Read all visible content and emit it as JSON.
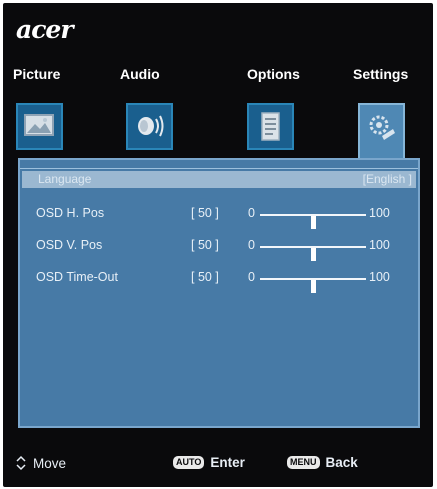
{
  "brand": {
    "logo_text": "acer"
  },
  "tabs": [
    {
      "label": "Picture",
      "icon": "picture-icon"
    },
    {
      "label": "Audio",
      "icon": "audio-icon"
    },
    {
      "label": "Options",
      "icon": "options-icon"
    },
    {
      "label": "Settings",
      "icon": "settings-icon",
      "active": true
    }
  ],
  "settings": {
    "language": {
      "label": "Language",
      "value": "[English ]"
    },
    "rows": [
      {
        "label": "OSD H. Pos",
        "value": "[ 50 ]",
        "min": "0",
        "max": "100",
        "level": 50
      },
      {
        "label": "OSD V. Pos",
        "value": "[ 50 ]",
        "min": "0",
        "max": "100",
        "level": 50
      },
      {
        "label": "OSD Time-Out",
        "value": "[ 50 ]",
        "min": "0",
        "max": "100",
        "level": 50
      }
    ]
  },
  "footer": {
    "move_label": "Move",
    "auto_key": "AUTO",
    "enter_label": "Enter",
    "menu_key": "MENU",
    "back_label": "Back"
  },
  "colors": {
    "background": "#0a0a0c",
    "panel": "#477aa6",
    "highlight_row": "#9bb8d1",
    "icon_border": "#2a86b8"
  }
}
